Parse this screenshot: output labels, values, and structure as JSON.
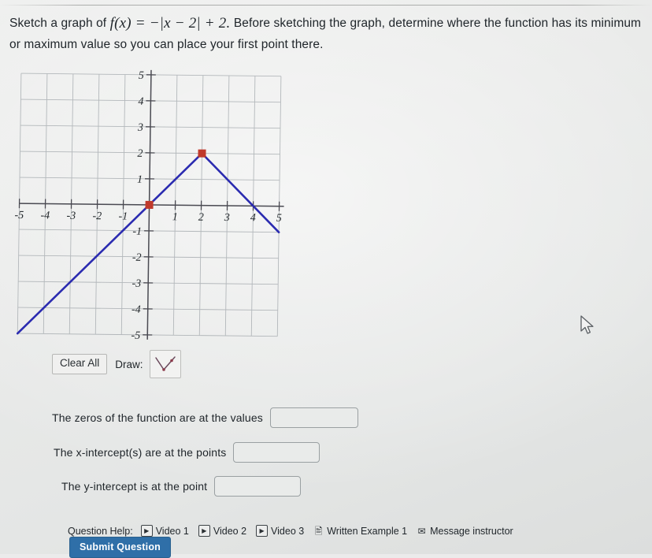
{
  "prompt": {
    "lead": "Sketch a graph of",
    "equation": "f(x) = −|x − 2| + 2.",
    "tail": "Before sketching the graph, determine where the function has its minimum or maximum value so you can place your first point there."
  },
  "graph_toolbar": {
    "clear_all_label": "Clear All",
    "draw_label": "Draw:",
    "draw_tool_icon": "absolute-value-v-shape-icon"
  },
  "answers": [
    {
      "label": "The zeros of the function are at the values",
      "value": "",
      "placeholder": ""
    },
    {
      "label": "The x-intercept(s) are at the points",
      "value": "",
      "placeholder": ""
    },
    {
      "label": "The y-intercept is at the point",
      "value": "",
      "placeholder": ""
    }
  ],
  "question_help": {
    "label": "Question Help:",
    "items": [
      {
        "text": "Video 1",
        "icon": "video-play-icon"
      },
      {
        "text": "Video 2",
        "icon": "video-play-icon"
      },
      {
        "text": "Video 3",
        "icon": "video-play-icon"
      },
      {
        "text": "Written Example 1",
        "icon": "document-icon"
      },
      {
        "text": "Message instructor",
        "icon": "envelope-icon"
      }
    ]
  },
  "submit": {
    "label": "Submit Question"
  },
  "colors": {
    "curve": "#2b2bb0",
    "point": "#c0392b",
    "axis": "#4a4a52",
    "grid": "#a9aeb2",
    "submit_blue": "#2f6fa8"
  },
  "chart_data": {
    "type": "line",
    "title": "",
    "xlabel": "",
    "ylabel": "",
    "xlim": [
      -5,
      5
    ],
    "ylim": [
      -5,
      5
    ],
    "xticks": [
      -5,
      -4,
      -3,
      -2,
      -1,
      1,
      2,
      3,
      4,
      5
    ],
    "yticks": [
      -5,
      -4,
      -3,
      -2,
      -1,
      1,
      2,
      3,
      4,
      5
    ],
    "xtick_labels": [
      "-5",
      "-4",
      "-3",
      "-2",
      "-1",
      "1",
      "2",
      "3",
      "4",
      "5"
    ],
    "ytick_labels": [
      "-5",
      "-4",
      "-3",
      "-2",
      "-1",
      "1",
      "2",
      "3",
      "4",
      "5"
    ],
    "grid": true,
    "legend": "none",
    "series": [
      {
        "name": "f(x) = -|x - 2| + 2",
        "color": "#2b2bb0",
        "x": [
          -5,
          2,
          5
        ],
        "y": [
          -5,
          2,
          -1
        ]
      }
    ],
    "plotted_points": [
      {
        "x": 0,
        "y": 0,
        "marker": "square",
        "color": "#c0392b"
      },
      {
        "x": 2,
        "y": 2,
        "marker": "square",
        "color": "#c0392b"
      }
    ],
    "vertex": {
      "x": 2,
      "y": 2
    },
    "x_intercepts": [
      0,
      4
    ],
    "y_intercept": 0
  }
}
